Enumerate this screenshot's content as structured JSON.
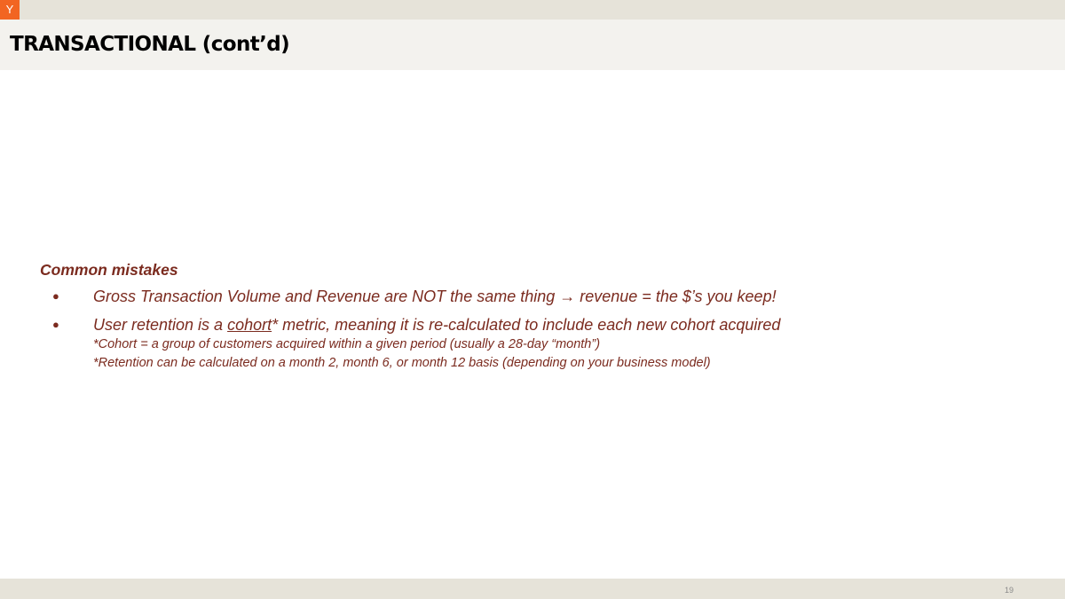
{
  "header": {
    "logo_letter": "Y",
    "title": "TRANSACTIONAL (cont’d)"
  },
  "colors": {
    "logo": "#f26522",
    "body_text": "#7b2b1f",
    "band": "#e6e3d9"
  },
  "content": {
    "heading": "Common mistakes",
    "bullet_1": "Gross Transaction Volume and Revenue are NOT the same thing → revenue = the $’s you keep!",
    "bullet_2": {
      "before": "User retention is a ",
      "underlined": "cohort",
      "after": "* metric, meaning it is re-calculated to include each new cohort acquired",
      "notes": [
        "*Cohort = a group of customers acquired within a given period (usually a 28-day “month”)",
        "*Retention can be calculated on a month 2, month 6, or month 12 basis (depending on your business model)"
      ]
    },
    "bullet_marker": "●"
  },
  "footer": {
    "page_number": "19"
  }
}
